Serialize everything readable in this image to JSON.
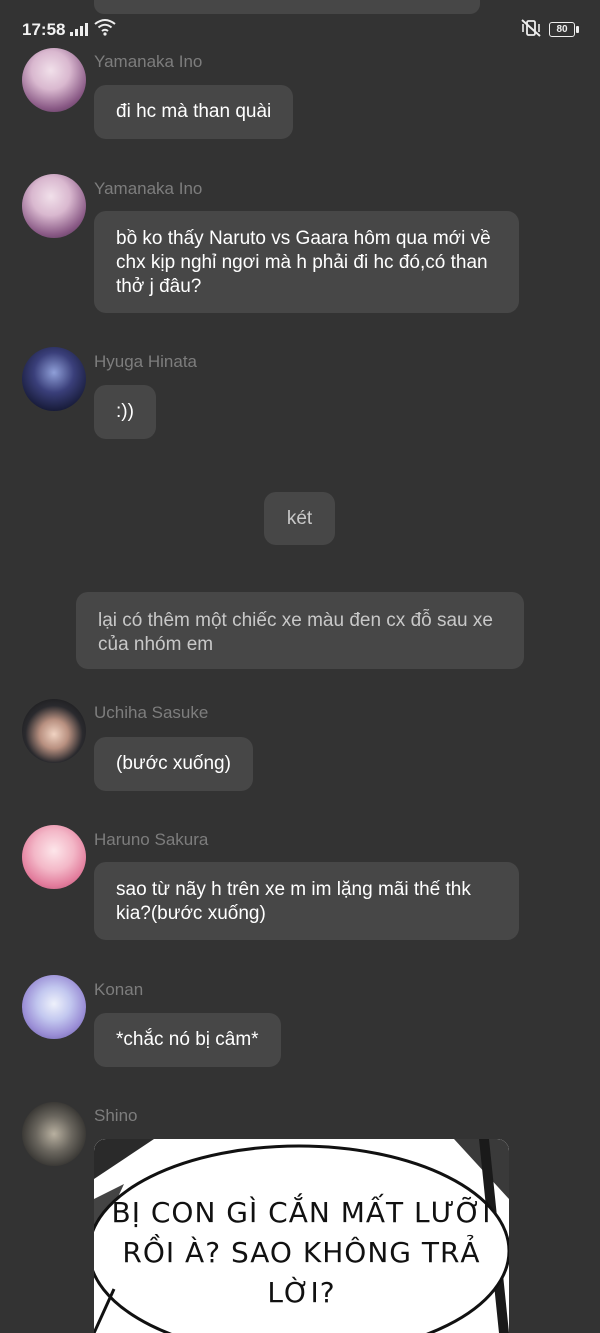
{
  "status": {
    "time": "17:58",
    "battery": "80"
  },
  "messages": [
    {
      "sender": "Yamanaka Ino",
      "text": "đi hc mà than quài"
    },
    {
      "sender": "Yamanaka Ino",
      "text": "bồ ko thấy Naruto vs Gaara hôm qua mới về chx kịp nghỉ ngơi mà h phải đi hc đó,có than thở j đâu?"
    },
    {
      "sender": "Hyuga Hinata",
      "text": ":))"
    },
    {
      "sender": "",
      "text": "két"
    },
    {
      "sender": "",
      "text": "lại có thêm một chiếc xe màu đen cx đỗ sau xe của nhóm em"
    },
    {
      "sender": "Uchiha Sasuke",
      "text": "(bước xuống)"
    },
    {
      "sender": "Haruno Sakura",
      "text": "sao từ nãy h trên xe m im lặng mãi thế thk kia?(bước xuống)"
    },
    {
      "sender": "Konan",
      "text": "*chắc nó bị câm*"
    },
    {
      "sender": "Shino",
      "image_text": "BỊ CON GÌ CẮN MẤT LƯỠI RỒI À? SAO KHÔNG TRẢ LỜI?"
    }
  ],
  "colors": {
    "background": "#333333",
    "bubble": "#474747",
    "name": "#7d7d7d"
  }
}
